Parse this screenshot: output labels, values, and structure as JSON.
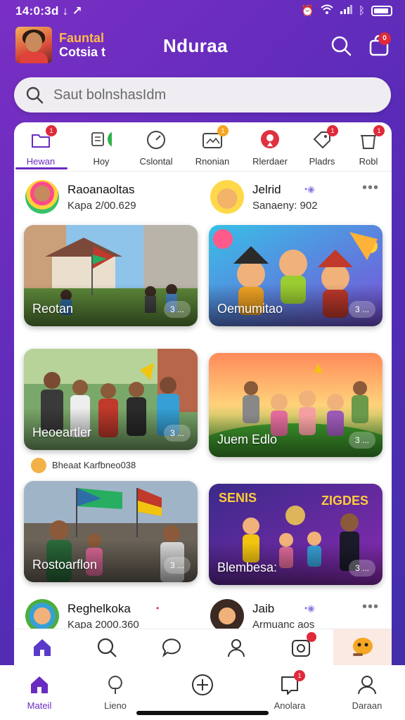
{
  "status_bar": {
    "time": "14:0:3d ↓ ↗"
  },
  "header": {
    "brand_line1": "Fauntal",
    "brand_line2": "Cotsia t",
    "title": "Nduraa",
    "bag_badge": "0"
  },
  "search": {
    "placeholder": "Saut bolnshasIdm"
  },
  "categories": [
    {
      "label": "Hewan",
      "icon": "folder-icon",
      "badge": "1",
      "active": true
    },
    {
      "label": "Hoy",
      "icon": "chat-bubble-icon",
      "badge": ""
    },
    {
      "label": "Cslontal",
      "icon": "clock-icon",
      "badge": ""
    },
    {
      "label": "Rnonian",
      "icon": "image-frame-icon",
      "badge": "1"
    },
    {
      "label": "Rlerdaer",
      "icon": "location-pin-icon",
      "badge": ""
    },
    {
      "label": "Pladrs",
      "icon": "tag-icon",
      "badge": "1"
    },
    {
      "label": "Robl",
      "icon": "trash-icon",
      "badge": "1"
    }
  ],
  "users": {
    "top_left": {
      "name": "Raoanaoltas",
      "sub": "Kapa 2/00.629"
    },
    "top_right": {
      "name": "Jelrid",
      "sub": "Sanaeny: 902"
    },
    "bottom_left": {
      "name": "Reghelkoka",
      "sub": "Kapa 2000.360"
    },
    "bottom_right": {
      "name": "Jaib",
      "sub": "Armuanc aos"
    }
  },
  "cards": [
    {
      "title": "Reotan",
      "more": "3 ..."
    },
    {
      "title": "Oemumitao",
      "more": "3 ..."
    },
    {
      "title": "Heoeartler",
      "more": "3 ..."
    },
    {
      "title": "Juem Edlo",
      "more": "3 ..."
    },
    {
      "title": "Rostoarflon",
      "more": "3 ..."
    },
    {
      "title": "Blembesa:",
      "more": "3 ..."
    }
  ],
  "caption": {
    "text": "Bheaat Karfbneo038"
  },
  "bottom_nav": [
    {
      "label": "Mateil",
      "icon": "home-icon",
      "active": true
    },
    {
      "label": "Lieno",
      "icon": "tree-icon"
    },
    {
      "label": "",
      "icon": "add-circle-icon"
    },
    {
      "label": "Anolara",
      "icon": "inbox-icon",
      "badge": "1"
    },
    {
      "label": "Daraan",
      "icon": "profile-icon"
    }
  ],
  "colors": {
    "accent": "#6a2bc0",
    "badge": "#e02a3a",
    "brand_orange": "#ffb84a"
  }
}
